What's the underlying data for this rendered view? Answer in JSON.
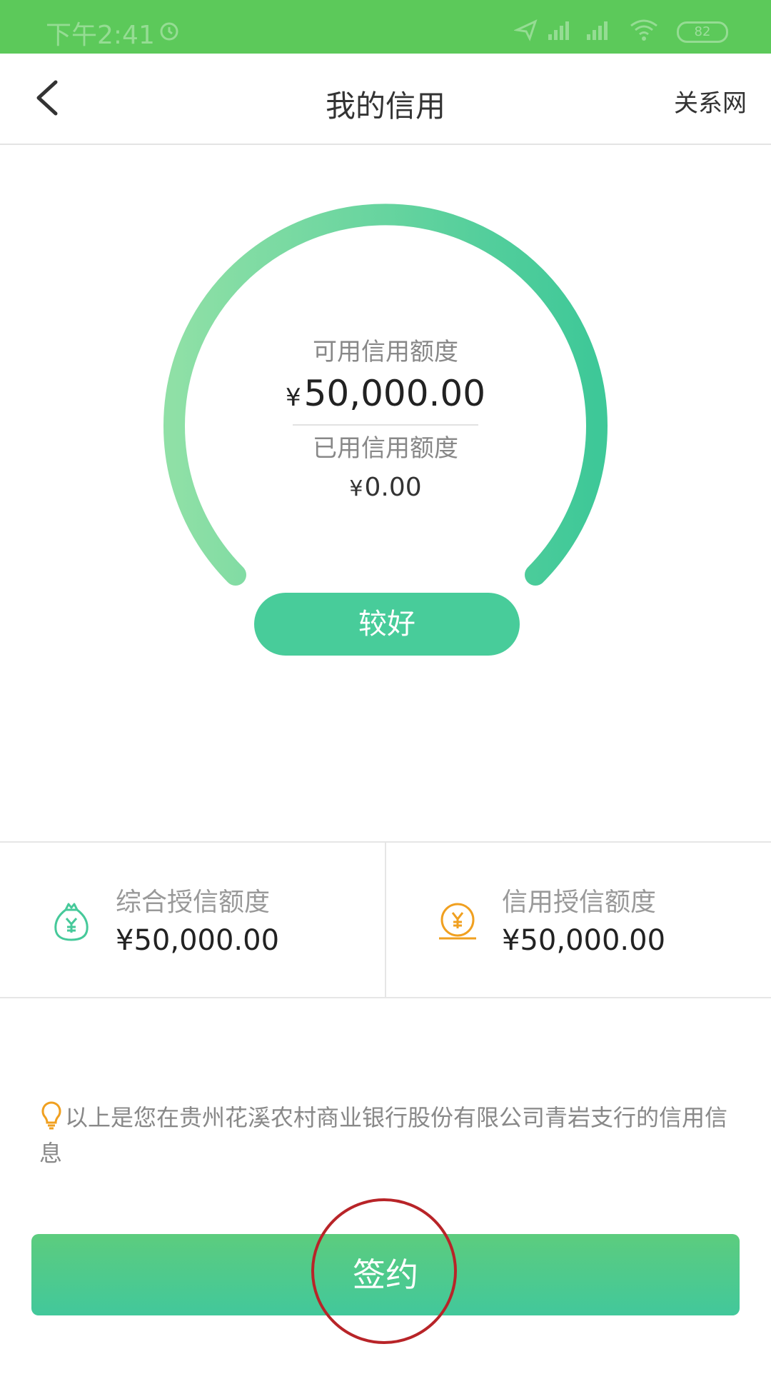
{
  "status_bar": {
    "time": "下午2:41",
    "battery": "82",
    "icons": [
      "alarm-icon",
      "airplane-icon",
      "signal-icon",
      "signal-icon",
      "wifi-icon",
      "battery-icon"
    ]
  },
  "nav": {
    "back_icon": "back-chevron-icon",
    "title": "我的信用",
    "network_link": "关系网"
  },
  "gauge": {
    "available_label": "可用信用额度",
    "available_currency": "¥",
    "available_value": "50,000.00",
    "used_label": "已用信用额度",
    "used_currency": "¥",
    "used_value": "0.00",
    "rating": "较好",
    "colors": {
      "start": "#8fe0a6",
      "end": "#3ec898"
    }
  },
  "limits": [
    {
      "icon": "money-bag-icon",
      "label": "综合授信额度",
      "value": "¥50,000.00",
      "icon_color": "#46c99a"
    },
    {
      "icon": "coin-icon",
      "label": "信用授信额度",
      "value": "¥50,000.00",
      "icon_color": "#f0a020"
    }
  ],
  "info": {
    "icon": "lightbulb-icon",
    "text": "以上是您在贵州花溪农村商业银行股份有限公司青岩支行的信用信息"
  },
  "sign_button": {
    "label": "签约"
  }
}
